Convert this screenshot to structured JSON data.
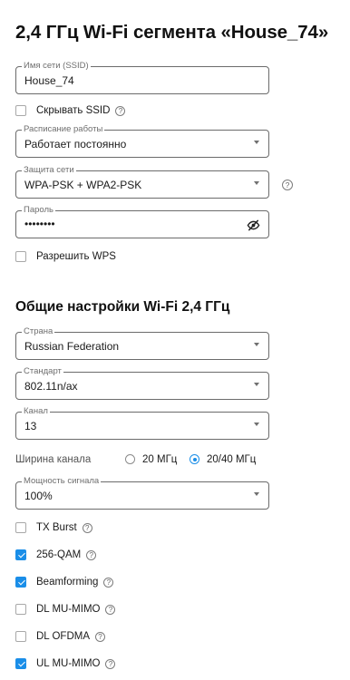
{
  "segment": {
    "title": "2,4 ГГц Wi-Fi сегмента «House_74»",
    "ssid": {
      "label": "Имя сети (SSID)",
      "value": "House_74"
    },
    "hide_ssid": {
      "label": "Скрывать SSID",
      "checked": false
    },
    "schedule": {
      "label": "Расписание работы",
      "value": "Работает постоянно"
    },
    "security": {
      "label": "Защита сети",
      "value": "WPA-PSK + WPA2-PSK"
    },
    "password": {
      "label": "Пароль",
      "value": "••••••••"
    },
    "wps": {
      "label": "Разрешить WPS",
      "checked": false
    }
  },
  "general": {
    "title": "Общие настройки Wi-Fi 2,4 ГГц",
    "country": {
      "label": "Страна",
      "value": "Russian Federation"
    },
    "standard": {
      "label": "Стандарт",
      "value": "802.11n/ax"
    },
    "channel": {
      "label": "Канал",
      "value": "13"
    },
    "channel_width": {
      "label": "Ширина канала",
      "options": [
        "20 МГц",
        "20/40 МГц"
      ],
      "selected": "20/40 МГц"
    },
    "power": {
      "label": "Мощность сигнала",
      "value": "100%"
    },
    "options": [
      {
        "label": "TX Burst",
        "checked": false
      },
      {
        "label": "256-QAM",
        "checked": true
      },
      {
        "label": "Beamforming",
        "checked": true
      },
      {
        "label": "DL MU-MIMO",
        "checked": false
      },
      {
        "label": "DL OFDMA",
        "checked": false
      },
      {
        "label": "UL MU-MIMO",
        "checked": true
      }
    ]
  },
  "icons": {
    "help": "question-circle-icon",
    "dropdown": "caret-down-icon",
    "password_toggle": "eye-off-icon"
  },
  "colors": {
    "accent": "#1a8ee8",
    "border": "#6b6b6b",
    "text": "#1a1a1a",
    "label": "#6e6e6e"
  }
}
